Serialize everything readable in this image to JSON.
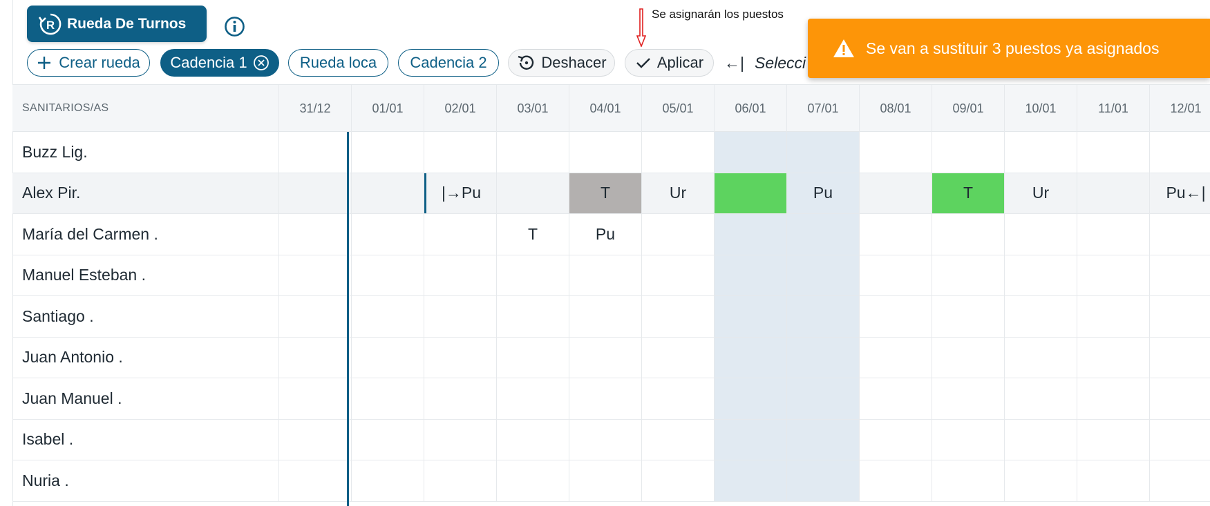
{
  "header": {
    "brand_label": "Rueda De Turnos",
    "annotation": "Se asignarán los puestos",
    "chips": [
      {
        "label": "Crear rueda"
      },
      {
        "label": "Cadencia 1"
      },
      {
        "label": "Rueda loca"
      },
      {
        "label": "Cadencia 2"
      }
    ],
    "undo_label": "Deshacer",
    "apply_label": "Aplicar",
    "select_arrow": "←|",
    "select_label": "Selecci"
  },
  "toast": {
    "message": "Se van a sustituir 3 puestos ya asignados",
    "color": "#fd9508"
  },
  "grid": {
    "first_header": "SANITARIOS/AS",
    "dates": [
      "31/12",
      "01/01",
      "02/01",
      "03/01",
      "04/01",
      "05/01",
      "06/01",
      "07/01",
      "08/01",
      "09/01",
      "10/01",
      "11/01",
      "12/01"
    ],
    "rows": [
      {
        "name": "Buzz Lig.",
        "cells": [
          "",
          "",
          "",
          "",
          "",
          "",
          "",
          "",
          "",
          "",
          "",
          "",
          ""
        ]
      },
      {
        "name": "Alex Pir.",
        "cells": [
          "",
          "",
          "|→Pu",
          "",
          "T",
          "Ur",
          "",
          "Pu",
          "",
          "T",
          "Ur",
          "",
          "Pu←|"
        ]
      },
      {
        "name": "María del Carmen .",
        "cells": [
          "",
          "",
          "",
          "T",
          "Pu",
          "",
          "",
          "",
          "",
          "",
          "",
          "",
          ""
        ]
      },
      {
        "name": "Manuel Esteban .",
        "cells": [
          "",
          "",
          "",
          "",
          "",
          "",
          "",
          "",
          "",
          "",
          "",
          "",
          ""
        ]
      },
      {
        "name": "Santiago .",
        "cells": [
          "",
          "",
          "",
          "",
          "",
          "",
          "",
          "",
          "",
          "",
          "",
          "",
          ""
        ]
      },
      {
        "name": "Juan Antonio .",
        "cells": [
          "",
          "",
          "",
          "",
          "",
          "",
          "",
          "",
          "",
          "",
          "",
          "",
          ""
        ]
      },
      {
        "name": "Juan Manuel .",
        "cells": [
          "",
          "",
          "",
          "",
          "",
          "",
          "",
          "",
          "",
          "",
          "",
          "",
          ""
        ]
      },
      {
        "name": "Isabel .",
        "cells": [
          "",
          "",
          "",
          "",
          "",
          "",
          "",
          "",
          "",
          "",
          "",
          "",
          ""
        ]
      },
      {
        "name": "Nuria .",
        "cells": [
          "",
          "",
          "",
          "",
          "",
          "",
          "",
          "",
          "",
          "",
          "",
          "",
          ""
        ]
      }
    ],
    "colors": {
      "accent": "#0e5f86",
      "green": "#5dd35f",
      "grey": "#b3b0af",
      "weekend": "#e1eaf2"
    }
  }
}
